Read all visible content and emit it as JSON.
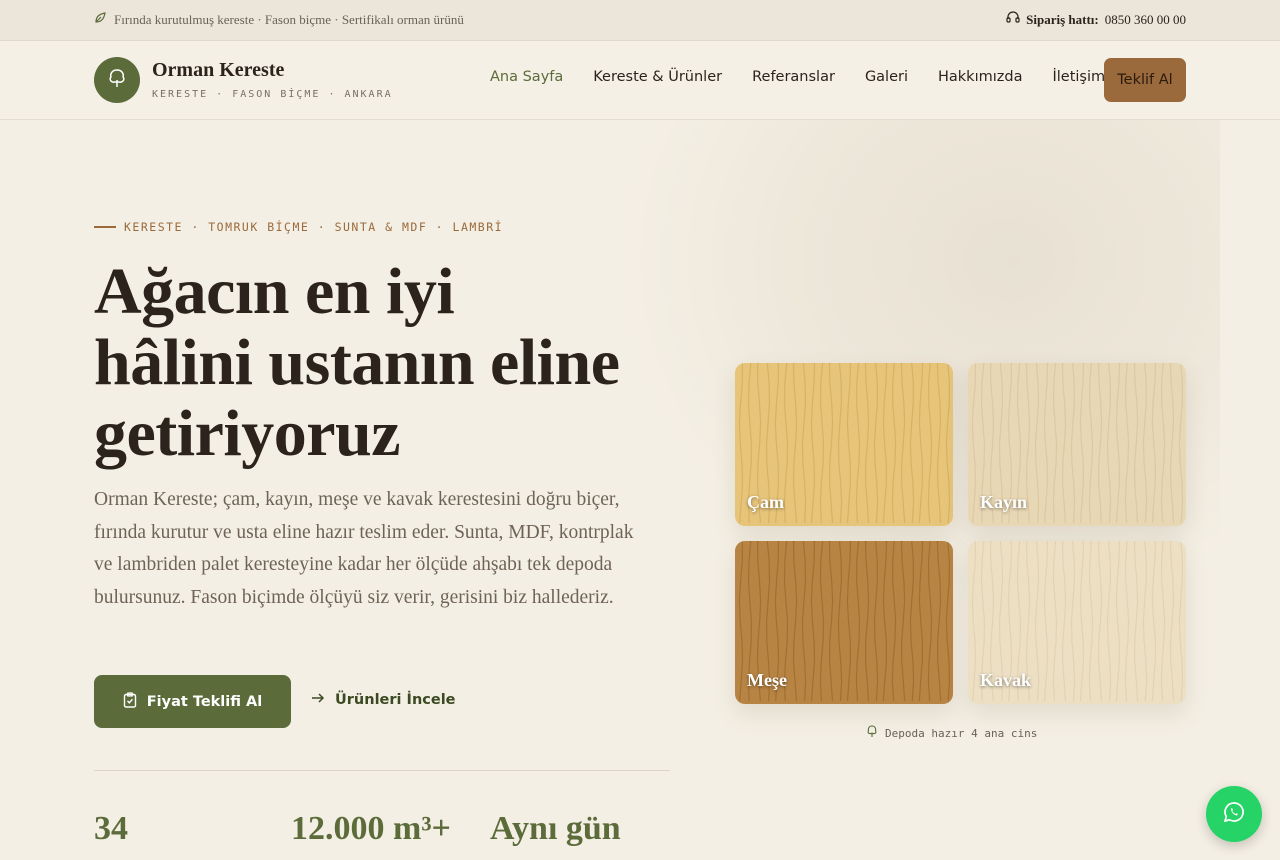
{
  "topbar": {
    "tagline": "Fırında kurutulmuş kereste · Fason biçme · Sertifikalı orman ürünü",
    "phone_label": "Sipariş hattı:",
    "phone_number": "0850 360 00 00"
  },
  "brand": {
    "name": "Orman Kereste",
    "tagline": "KERESTE · FASON BİÇME · ANKARA"
  },
  "nav": {
    "items": [
      "Ana Sayfa",
      "Kereste & Ürünler",
      "Referanslar",
      "Galeri",
      "Hakkımızda",
      "İletişim"
    ],
    "active": "Ana Sayfa",
    "cta": "Teklif Al"
  },
  "hero": {
    "eyebrow": "KERESTE · TOMRUK BİÇME · SUNTA & MDF · LAMBRİ",
    "title_lines": [
      "Ağacın en iyi",
      "hâlini ustanın eline",
      "getiriyoruz"
    ],
    "description": "Orman Kereste; çam, kayın, meşe ve kavak kerestesini doğru biçer, fırında kurutur ve usta eline hazır teslim eder. Sunta, MDF, kontrplak ve lambriden palet keresteyine kadar her ölçüde ahşabı tek depoda bulursunuz. Fason biçimde ölçüyü siz verir, gerisini biz hallederiz.",
    "primary_button": "Fiyat Teklifi Al",
    "secondary_link": "Ürünleri İncele"
  },
  "stats": [
    "34",
    "12.000 m³+",
    "Aynı gün"
  ],
  "wood": {
    "tiles": [
      {
        "name": "Çam",
        "color": "#e6c47a",
        "stripe": "#d4ac5c"
      },
      {
        "name": "Kayın",
        "color": "#e8d7b4",
        "stripe": "#d9c49c"
      },
      {
        "name": "Meşe",
        "color": "#b78444",
        "stripe": "#9c6a30"
      },
      {
        "name": "Kavak",
        "color": "#ecdfc4",
        "stripe": "#dfcfae"
      }
    ],
    "caption": "Depoda hazır 4 ana cins"
  },
  "colors": {
    "accent_green": "#5b6b3a",
    "accent_brown": "#9a6a3c",
    "background": "#f4efe4",
    "whatsapp": "#25d366"
  },
  "icons": {
    "topbar": "leaf-icon",
    "phone": "headset-icon",
    "logo": "tree-icon",
    "primary_button": "clipboard-icon",
    "secondary_link": "arrow-right-icon",
    "caption": "tree-icon",
    "float": "whatsapp-icon"
  }
}
